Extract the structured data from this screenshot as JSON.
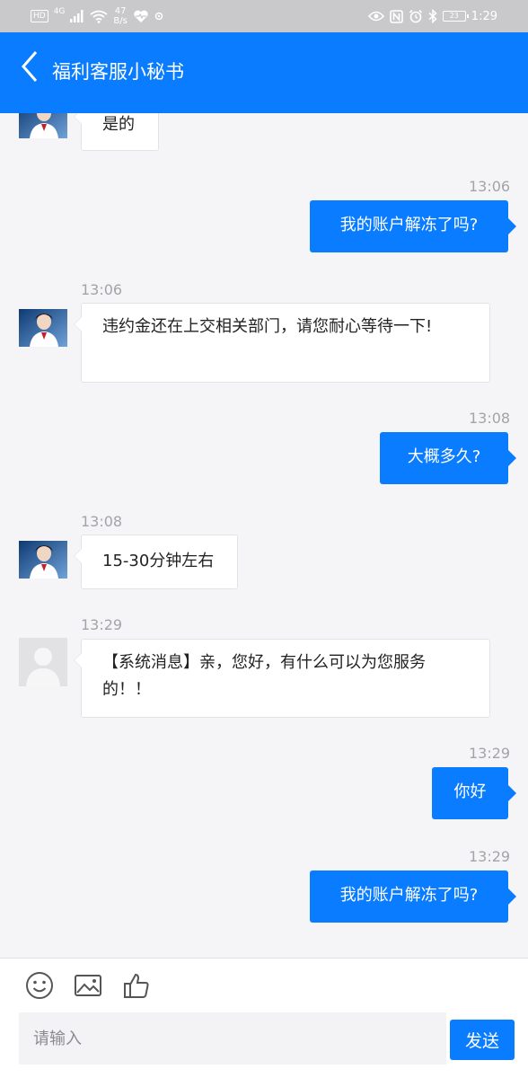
{
  "status_bar": {
    "hd": "HD",
    "signal": "4G",
    "speed_value": "47",
    "speed_unit": "B/s",
    "battery": "23",
    "time": "1:29"
  },
  "header": {
    "title": "福利客服小秘书"
  },
  "messages": [
    {
      "from": "agent",
      "text": "是的"
    },
    {
      "time": "13:06",
      "from": "user",
      "text": "我的账户解冻了吗?"
    },
    {
      "time": "13:06",
      "from": "agent",
      "text": "违约金还在上交相关部门，请您耐心等待一下!"
    },
    {
      "time": "13:08",
      "from": "user",
      "text": "大概多久?"
    },
    {
      "time": "13:08",
      "from": "agent",
      "text": "15-30分钟左右"
    },
    {
      "time": "13:29",
      "from": "system",
      "text": "【系统消息】亲，您好，有什么可以为您服务的！！"
    },
    {
      "time": "13:29",
      "from": "user",
      "text": "你好"
    },
    {
      "time": "13:29",
      "from": "user",
      "text": "我的账户解冻了吗?"
    }
  ],
  "composer": {
    "placeholder": "请输入",
    "send_label": "发送"
  },
  "colors": {
    "accent": "#0a7cff",
    "status_bar": "#c9c9cc",
    "chat_bg": "#f5f5f7"
  }
}
